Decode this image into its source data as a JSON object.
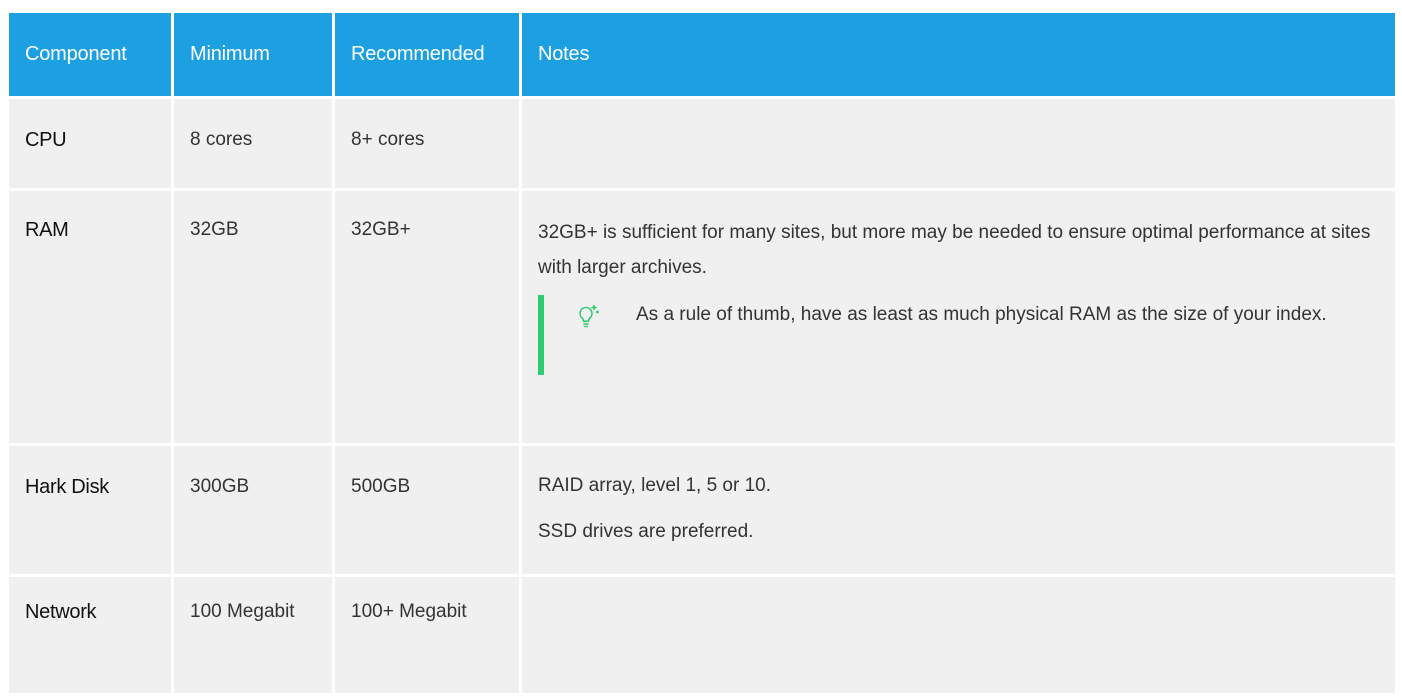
{
  "table": {
    "headers": [
      "Component",
      "Minimum",
      "Recommended",
      "Notes"
    ],
    "rows": {
      "cpu": {
        "component": "CPU",
        "minimum": "8 cores",
        "recommended": "8+ cores",
        "notes": ""
      },
      "ram": {
        "component": "RAM",
        "minimum": "32GB",
        "recommended": "32GB+",
        "notes": "32GB+ is sufficient for many sites, but more may be needed to ensure optimal performance at sites with larger archives.",
        "tip": {
          "icon": "lightbulb-icon",
          "text": "As a rule of thumb, have as least as much physical RAM as the size of your index."
        }
      },
      "disk": {
        "component": "Hark Disk",
        "minimum": "300GB",
        "recommended": "500GB",
        "notes": [
          "RAID array, level 1, 5 or 10.",
          "SSD drives are preferred."
        ]
      },
      "network": {
        "component": "Network",
        "minimum": "100 Megabit",
        "recommended": "100+ Megabit",
        "notes": ""
      }
    }
  },
  "colors": {
    "header_bg": "#1ca0e1",
    "cell_bg": "#f0f0f0",
    "tip_accent": "#2ecc71"
  }
}
